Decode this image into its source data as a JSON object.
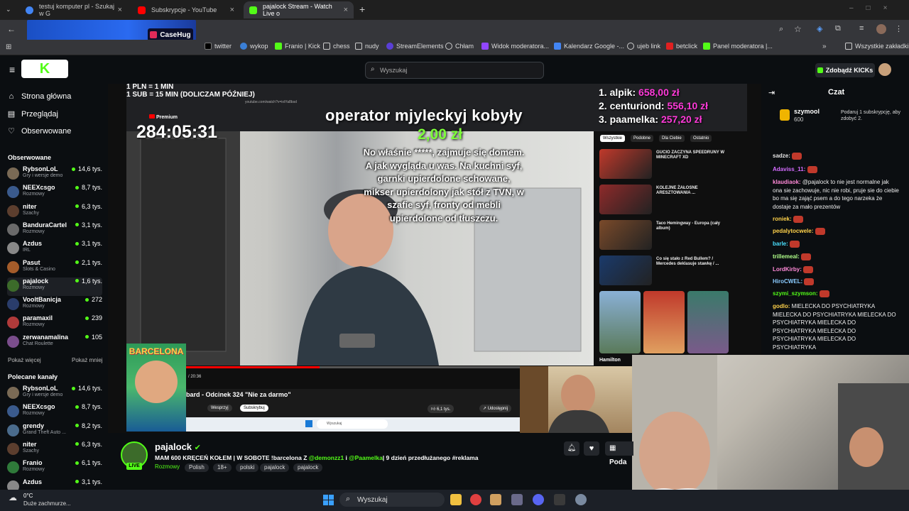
{
  "browser": {
    "tabs": [
      {
        "title": "testuj komputer pl - Szukaj w G",
        "color": "#4285f4"
      },
      {
        "title": "Subskrypcje - YouTube",
        "color": "#ff0000"
      },
      {
        "title": "pajalock Stream - Watch Live o",
        "color": "#53fc18"
      }
    ],
    "ad_text": "CaseHug",
    "bookmarks": [
      "twitter",
      "wykop",
      "Franio | Kick",
      "chess",
      "nudy",
      "StreamElements",
      "Chłam",
      "Widok moderatora...",
      "Kalendarz Google -...",
      "ujeb link",
      "betclick",
      "Panel moderatora |..."
    ],
    "all_bookmarks": "Wszystkie zakładki"
  },
  "kick": {
    "logo": "K",
    "search_placeholder": "Wyszukaj",
    "kicks_button": "Zdobądź KICKs"
  },
  "sidebar": {
    "nav": [
      {
        "label": "Strona główna",
        "icon": "home-icon"
      },
      {
        "label": "Przeglądaj",
        "icon": "browse-icon"
      },
      {
        "label": "Obserwowane",
        "icon": "heart-icon"
      }
    ],
    "followed_title": "Obserwowane",
    "followed": [
      {
        "name": "RybsonLoL",
        "cat": "Gry i wersje demo",
        "viewers": "14,6 tys.",
        "color": "#7a6a55"
      },
      {
        "name": "NEEXcsgo",
        "cat": "Rozmowy",
        "viewers": "8,7 tys.",
        "color": "#3a5a8c"
      },
      {
        "name": "niter",
        "cat": "Szachy",
        "viewers": "6,3 tys.",
        "color": "#5c3e2e"
      },
      {
        "name": "BanduraCartel",
        "cat": "Rozmowy",
        "viewers": "3,1 tys.",
        "color": "#6a6a6a"
      },
      {
        "name": "Azdus",
        "cat": "IRL",
        "viewers": "3,1 tys.",
        "color": "#888"
      },
      {
        "name": "Pasut",
        "cat": "Slots & Casino",
        "viewers": "2,1 tys.",
        "color": "#a45c2a"
      },
      {
        "name": "pajalock",
        "cat": "Rozmowy",
        "viewers": "1,6 tys.",
        "color": "#3c6b2a"
      },
      {
        "name": "VooltBanicja",
        "cat": "Rozmowy",
        "viewers": "272",
        "color": "#2a3d6b"
      },
      {
        "name": "paramaxil",
        "cat": "Rozmowy",
        "viewers": "239",
        "color": "#b03a3a"
      },
      {
        "name": "zerwanamalina",
        "cat": "Chat Roulette",
        "viewers": "105",
        "color": "#7a4d8c"
      }
    ],
    "show_more": "Pokaż więcej",
    "show_less": "Pokaż mniej",
    "recommended_title": "Polecane kanały",
    "recommended": [
      {
        "name": "RybsonLoL",
        "cat": "Gry i wersje demo",
        "viewers": "14,6 tys.",
        "color": "#7a6a55"
      },
      {
        "name": "NEEXcsgo",
        "cat": "Rozmowy",
        "viewers": "8,7 tys.",
        "color": "#3a5a8c"
      },
      {
        "name": "grendy",
        "cat": "Grand Theft Auto ...",
        "viewers": "8,2 tys.",
        "color": "#4a6b8c"
      },
      {
        "name": "niter",
        "cat": "Szachy",
        "viewers": "6,3 tys.",
        "color": "#5c3e2e"
      },
      {
        "name": "Franio",
        "cat": "Rozmowy",
        "viewers": "6,1 tys.",
        "color": "#2f7a3a"
      },
      {
        "name": "Azdus",
        "cat": "",
        "viewers": "3,1 tys.",
        "color": "#888"
      }
    ]
  },
  "video": {
    "rate_line1": "1 PLN = 1 MIN",
    "rate_line2": "1 SUB = 15 MIN (DOLICZAM PÓŹNIEJ)",
    "timer": "284:05:31",
    "donation_title": "operator mjyleckyj kobyły",
    "donation_amount": "2,00 zł",
    "donation_message": "No właśnie *****, zajmuje się domem. A jak wygląda u was. Na kuchni syf, garnki upierdolone schowane, mikser upierdolony jak stół z TVN, w szafie syf, fronty od mebli upierdolone od tłuszczu.",
    "leaderboard": [
      {
        "rank": "1. alpik:",
        "amount": "658,00 zł"
      },
      {
        "rank": "2. centuriond:",
        "amount": "556,10 zł"
      },
      {
        "rank": "3. paamelka:",
        "amount": "257,20 zł"
      }
    ],
    "yt_premium": "Premium",
    "yt_url": "youtube.com/watch?v=ixtYa8bsd",
    "yt_filters": [
      "Wszystkie",
      "Podobne",
      "Dla Ciebie",
      "Ostatnio"
    ],
    "yt_videos": [
      {
        "title": "GUCIO ZACZYNA SPEEDRUNY W MINECRAFT XD",
        "color": "#c0392b"
      },
      {
        "title": "KOLEJNE ŻAŁOSNE ARESZTOWANIA ...",
        "color": "#8e2a2a"
      },
      {
        "title": "Taco Hemingway - Europa (cały album)",
        "color": "#7a4a2a"
      },
      {
        "title": "Co się stało z Red Bullem? / Mercedes deklasuje stawkę / ...",
        "color": "#1a3a6b"
      }
    ],
    "yt_episode": "bard - Odcinek 324 \"Nie za darmo\"",
    "yt_time": "/ 20:36",
    "yt_buttons": [
      "Wesprzyj",
      "Subskrybuj"
    ],
    "yt_likes": "6,1 tys.",
    "yt_share": "Udostępnij",
    "yt_search": "Wyszukaj",
    "hamilton": "Hamilton",
    "barca": "BARCELONA"
  },
  "stream": {
    "streamer": "pajalock",
    "live": "LIVE",
    "title_part1": "MAM 600 KRĘCEŃ KOŁEM | W SOBOTE !barcelona  Z ",
    "mention1": "@demonzz1",
    "title_mid": " i ",
    "mention2": "@Paamelka",
    "title_part2": "| 9 dzień przedłużanego #reklama",
    "tags": [
      "Rozmowy",
      "Polish",
      "18+",
      "polski",
      "pajalock",
      "pajalock"
    ],
    "follow_btn": "Poda"
  },
  "chat": {
    "title": "Czat",
    "pinned_user": "szymool",
    "pinned_count": "600",
    "pinned_text": "Podaruj 1 subskrypcję, aby zdobyć 2.",
    "messages": [
      {
        "user": "sadze:",
        "text": "",
        "color": "#e5e5e5"
      },
      {
        "user": "Adaviss_11:",
        "text": "",
        "color": "#d46cff"
      },
      {
        "user": "klaudiaok:",
        "text": "@pajalock to nie jest normalne jak ona sie zachowuje, nic nie robi, pruje sie do ciebie bo ma się zająć psem a do tego narzeka że dostaje za mało prezentów",
        "color": "#ff8ad8"
      },
      {
        "user": "roniek:",
        "text": "",
        "color": "#ffd24a"
      },
      {
        "user": "pedalytocwele:",
        "text": "",
        "color": "#ffd24a"
      },
      {
        "user": "barle:",
        "text": "",
        "color": "#4ae0ff"
      },
      {
        "user": "trillemeal:",
        "text": "",
        "color": "#b0ff8a"
      },
      {
        "user": "LordKirby:",
        "text": "",
        "color": "#ff8ad8"
      },
      {
        "user": "HiroCWEL:",
        "text": "",
        "color": "#8acbff"
      },
      {
        "user": "szymi_szymson:",
        "text": "",
        "color": "#53fc18"
      },
      {
        "user": "godlo:",
        "text": "MIELECKA DO PSYCHIATRYKA MIELECKA DO PSYCHIATRYKA MIELECKA DO PSYCHIATRYKA MIELECKA DO PSYCHIATRYKA MIELECKA DO PSYCHIATRYKA MIELECKA DO PSYCHIATRYKA",
        "color": "#ffd24a"
      }
    ]
  },
  "taskbar": {
    "weather_temp": "0°C",
    "weather_desc": "Duże zachmurze...",
    "search": "Wyszukaj"
  }
}
